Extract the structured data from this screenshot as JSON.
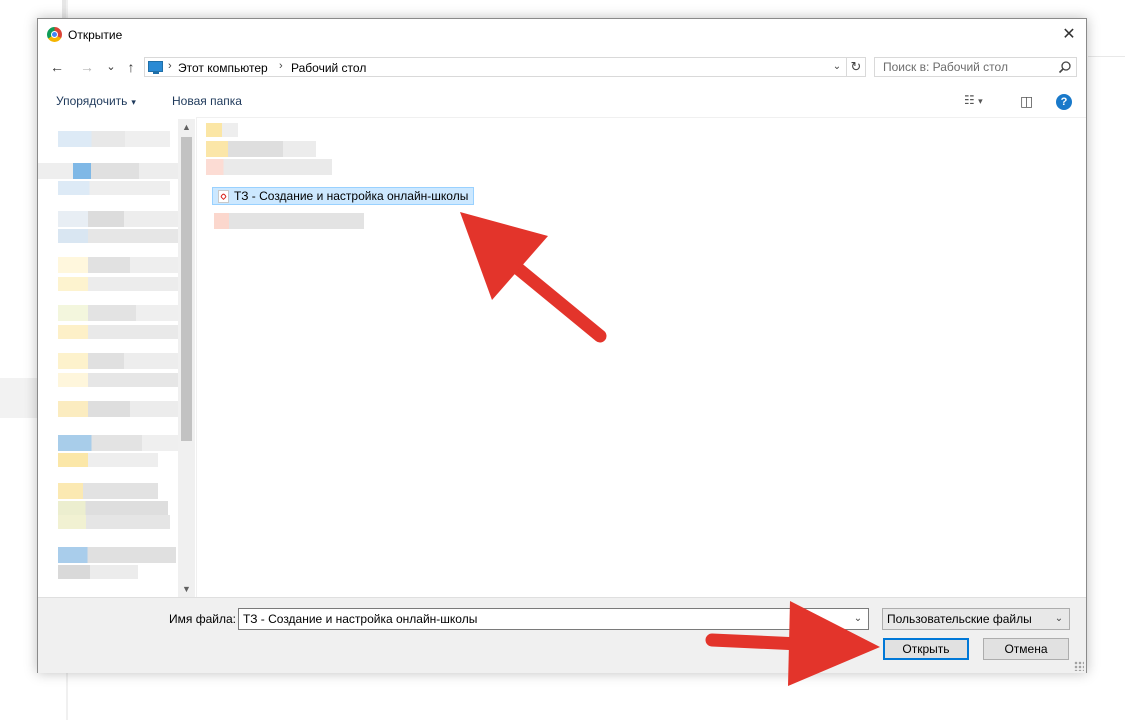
{
  "dialog": {
    "title": "Открытие",
    "close_glyph": "✕"
  },
  "nav": {
    "back_glyph": "←",
    "forward_glyph": "→",
    "recent_glyph": "⌄",
    "up_glyph": "↑",
    "breadcrumbs": [
      "Этот компьютер",
      "Рабочий стол"
    ],
    "separator": "›",
    "dropdown_glyph": "⌄",
    "refresh_glyph": "↻",
    "search_placeholder": "Поиск в: Рабочий стол"
  },
  "toolbar": {
    "organize_label": "Упорядочить",
    "organize_caret": "▾",
    "new_folder_label": "Новая папка",
    "view_glyph": "☷",
    "view_caret": "▾",
    "pane_glyph": "◫",
    "help_glyph": "?"
  },
  "scrollbar": {
    "up_glyph": "▲",
    "down_glyph": "▼"
  },
  "files": {
    "selected_file": "ТЗ - Создание и настройка онлайн-школы"
  },
  "bottom": {
    "filename_label": "Имя файла:",
    "filename_value": "ТЗ - Создание и настройка онлайн-школы",
    "filename_dropdown_glyph": "⌄",
    "filetype_label": "Пользовательские файлы",
    "filetype_dropdown_glyph": "⌄",
    "open_button": "Открыть",
    "cancel_button": "Отмена"
  },
  "colors": {
    "annotation_arrow": "#e3342b",
    "selection": "#cce8ff",
    "accent": "#0078d7"
  }
}
